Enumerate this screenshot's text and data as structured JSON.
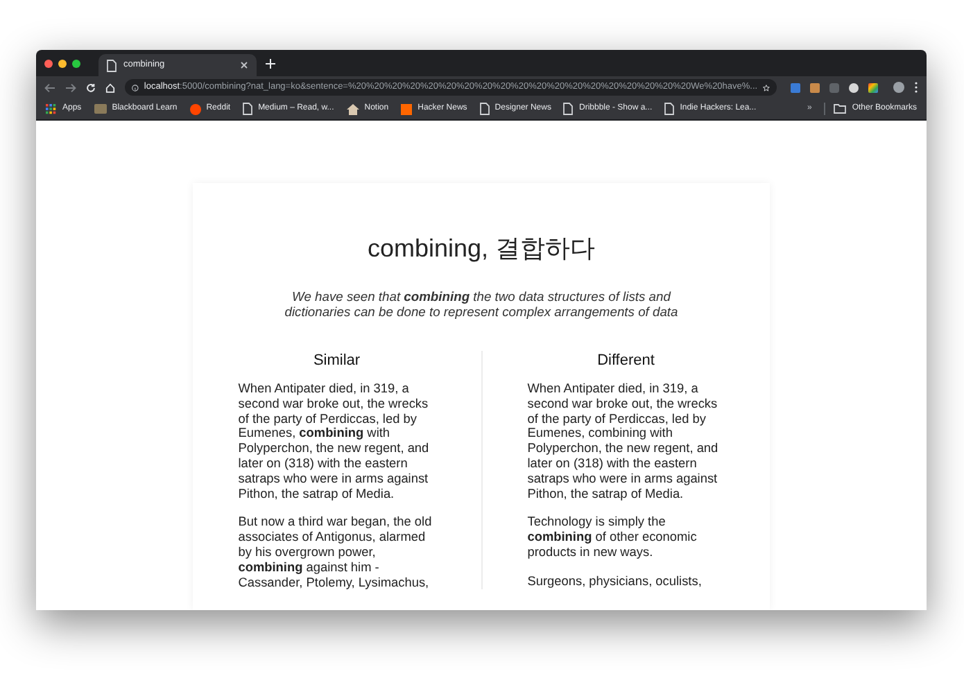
{
  "browser": {
    "tabs": [
      {
        "title": "combining",
        "selected": true
      }
    ],
    "address": {
      "host": "localhost",
      "rest": ":5000/combining?nat_lang=ko&sentence=%20%20%20%20%20%20%20%20%20%20%20%20%20%20%20%20%20%20%20We%20have%..."
    },
    "bookmarks": [
      {
        "label": "Apps",
        "kind": "grid"
      },
      {
        "label": "Blackboard Learn",
        "kind": "image"
      },
      {
        "label": "Reddit",
        "kind": "circle"
      },
      {
        "label": "Medium – Read, w...",
        "kind": "page"
      },
      {
        "label": "Notion",
        "kind": "house"
      },
      {
        "label": "Hacker News",
        "kind": "square"
      },
      {
        "label": "Designer News",
        "kind": "page"
      },
      {
        "label": "Dribbble - Show a...",
        "kind": "page"
      },
      {
        "label": "Indie Hackers: Lea...",
        "kind": "page"
      }
    ],
    "more_bookmarks": "»",
    "other_bookmarks": "Other Bookmarks"
  },
  "page": {
    "title": "combining, 결합하다",
    "subtitle": "We have seen that **combining** the two data structures of lists and dictionaries can be done to represent complex arrangements of data",
    "columns": [
      {
        "heading": "Similar",
        "paragraphs": [
          "When Antipater died, in 319, a second war broke out, the wrecks of the party of Perdiccas, led by Eumenes, **combining** with Polyperchon, the new regent, and later on (318) with the eastern satraps who were in arms against Pithon, the satrap of Media.",
          "But now a third war began, the old associates of Antigonus, alarmed by his overgrown power, **combining** against him - Cassander, Ptolemy, Lysimachus,"
        ]
      },
      {
        "heading": "Different",
        "paragraphs": [
          "When Antipater died, in 319, a second war broke out, the wrecks of the party of Perdiccas, led by Eumenes, combining with Polyperchon, the new regent, and later on (318) with the eastern satraps who were in arms against Pithon, the satrap of Media.",
          "Technology is simply the **combining** of other economic products in new ways.",
          "Surgeons, physicians, oculists,"
        ]
      }
    ]
  }
}
